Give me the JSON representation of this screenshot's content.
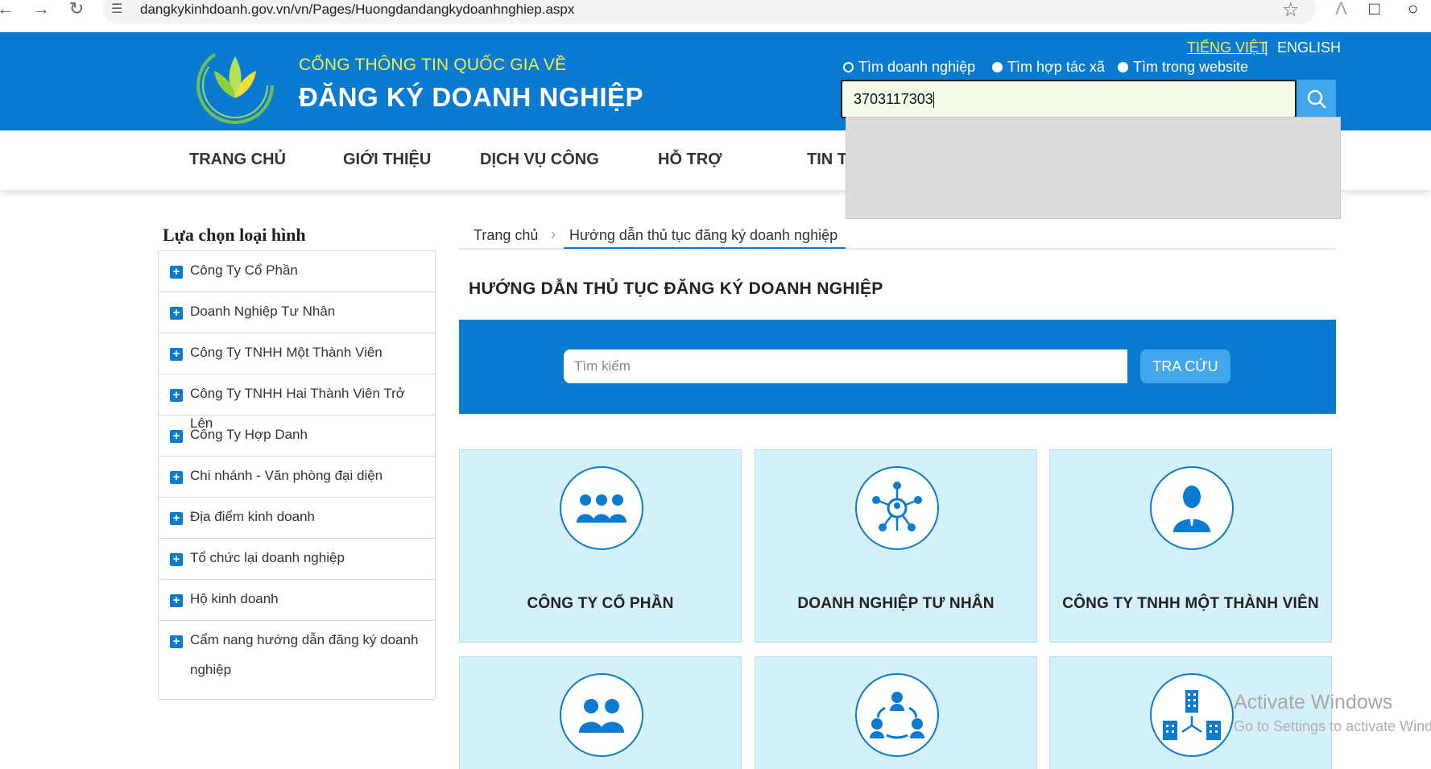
{
  "browser": {
    "back_icon": "arrow-left-icon",
    "forward_icon": "arrow-right-icon",
    "reload_icon": "reload-icon",
    "url": "dangkykinhdoanh.gov.vn/vn/Pages/Huongdandangkydoanhnghiep.aspx"
  },
  "header": {
    "title_top": "CỔNG THÔNG TIN QUỐC GIA VỀ",
    "title_main": "ĐĂNG KÝ DOANH NGHIỆP",
    "lang_vi": "TIẾNG VIỆT",
    "lang_sep": "|",
    "lang_en": "ENGLISH",
    "radio_options": [
      "Tìm doanh nghiệp",
      "Tìm hợp tác xã",
      "Tìm trong website"
    ],
    "search_value": "3703117303",
    "colors": {
      "primary": "#0a7bd0",
      "accent_yellow": "#f2ee4f",
      "button_blue": "#41a7ea"
    }
  },
  "nav": {
    "items": [
      "TRANG CHỦ",
      "GIỚI THIỆU",
      "DỊCH VỤ CÔNG",
      "HỖ TRỢ",
      "TIN T"
    ]
  },
  "sidebar": {
    "title": "Lựa chọn loại hình",
    "items": [
      "Công Ty Cổ Phần",
      "Doanh Nghiệp Tư Nhân",
      "Công Ty TNHH Một Thành Viên",
      "Công Ty TNHH Hai Thành Viên Trở Lên",
      "Công Ty Hợp Danh",
      "Chi nhánh - Văn phòng đại diện",
      "Địa điểm kinh doanh",
      "Tổ chức lại doanh nghiệp",
      "Hộ kinh doanh",
      "Cẩm nang hướng dẫn đăng ký doanh nghiệp"
    ]
  },
  "content": {
    "breadcrumb_home": "Trang chủ",
    "breadcrumb_sep": "›",
    "breadcrumb_current": "Hướng dẫn thủ tục đăng ký doanh nghiệp",
    "page_title": "HƯỚNG DẪN THỦ TỤC ĐĂNG KÝ DOANH NGHIỆP",
    "search_placeholder": "Tìm kiếm",
    "search_button": "TRA CỨU",
    "cards": [
      {
        "label": "CÔNG TY CỔ PHẦN",
        "icon": "group-of-people-icon"
      },
      {
        "label": "DOANH NGHIỆP TƯ NHÂN",
        "icon": "network-person-icon"
      },
      {
        "label": "CÔNG TY TNHH MỘT THÀNH VIÊN",
        "icon": "single-person-icon"
      },
      {
        "label": "",
        "icon": "two-people-icon"
      },
      {
        "label": "",
        "icon": "partnership-cycle-icon"
      },
      {
        "label": "",
        "icon": "branch-buildings-icon"
      }
    ]
  },
  "watermark": {
    "line1": "Activate Windows",
    "line2": "Go to Settings to activate Wind"
  }
}
